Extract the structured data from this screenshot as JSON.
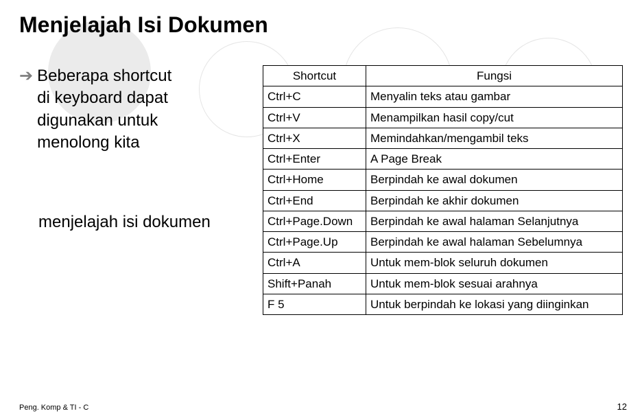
{
  "title": "Menjelajah Isi Dokumen",
  "bullet_text_lines": [
    "Beberapa shortcut",
    "di keyboard dapat",
    "digunakan untuk",
    "menolong kita"
  ],
  "bullet_overflow": "menjelajah isi dokumen",
  "table": {
    "headers": [
      "Shortcut",
      "Fungsi"
    ],
    "rows": [
      [
        "Ctrl+C",
        "Menyalin teks atau gambar"
      ],
      [
        "Ctrl+V",
        "Menampilkan hasil copy/cut"
      ],
      [
        "Ctrl+X",
        "Memindahkan/mengambil teks"
      ],
      [
        "Ctrl+Enter",
        "A Page Break"
      ],
      [
        "Ctrl+Home",
        "Berpindah ke awal dokumen"
      ],
      [
        "Ctrl+End",
        "Berpindah ke akhir dokumen"
      ],
      [
        "Ctrl+Page.Down",
        "Berpindah ke awal halaman Selanjutnya"
      ],
      [
        "Ctrl+Page.Up",
        "Berpindah ke awal halaman Sebelumnya"
      ],
      [
        "Ctrl+A",
        "Untuk mem-blok seluruh dokumen"
      ],
      [
        "Shift+Panah",
        "Untuk mem-blok sesuai arahnya"
      ],
      [
        "F 5",
        "Untuk berpindah ke lokasi yang diinginkan"
      ]
    ]
  },
  "footer_left": "Peng. Komp & TI - C",
  "footer_right": "12"
}
